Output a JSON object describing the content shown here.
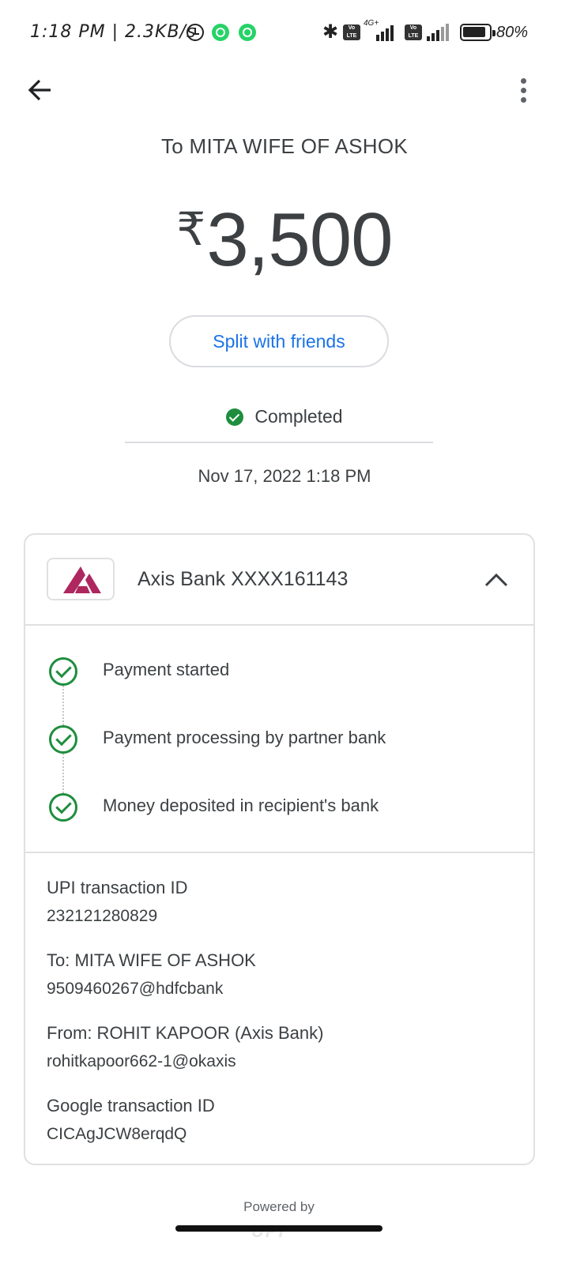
{
  "status_bar": {
    "time": "1:18 PM | 2.3KB/s",
    "network_4g": "4G+",
    "volte": "Vo LTE",
    "battery": "80%"
  },
  "header": {
    "back_icon": "arrow-left-icon",
    "menu_icon": "more-vert-icon"
  },
  "payment": {
    "to_title": "To MITA WIFE OF ASHOK",
    "currency_symbol": "₹",
    "amount": "3,500",
    "split_button": "Split with friends",
    "status": "Completed",
    "datetime": "Nov 17, 2022 1:18 PM"
  },
  "account": {
    "bank_name": "Axis Bank XXXX161143",
    "logo": "axis-bank-logo",
    "brand_color": "#ae275f"
  },
  "steps": [
    {
      "label": "Payment started"
    },
    {
      "label": "Payment processing by partner bank"
    },
    {
      "label": "Money deposited in recipient's bank"
    }
  ],
  "details": {
    "upi_label": "UPI transaction ID",
    "upi_value": "232121280829",
    "to_label": "To: MITA WIFE OF ASHOK",
    "to_value": "9509460267@hdfcbank",
    "from_label": "From: ROHIT KAPOOR (Axis Bank)",
    "from_value": "rohitkapoor662-1@okaxis",
    "google_label": "Google transaction ID",
    "google_value": "CICAgJCW8erqdQ"
  },
  "footer": {
    "powered_by": "Powered by",
    "upi_logo_text": "UPI"
  },
  "colors": {
    "accent_blue": "#1a73e8",
    "success_green": "#1e8e3e",
    "text_dark": "#3c4043"
  }
}
